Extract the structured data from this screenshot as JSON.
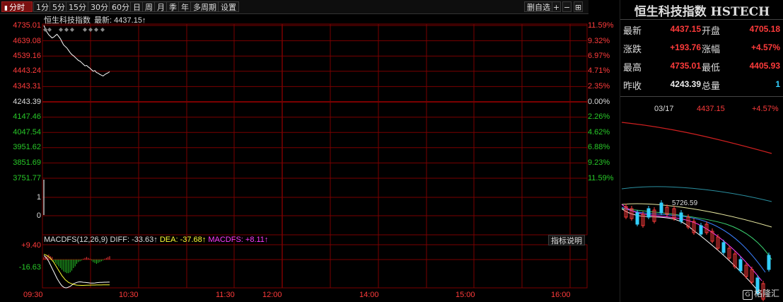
{
  "toolbar": {
    "tabs": [
      "分时",
      "1分",
      "5分",
      "15分",
      "30分",
      "60分",
      "日",
      "周",
      "月",
      "季",
      "年",
      "多周期",
      "设置"
    ],
    "active_index": 0,
    "delete_label": "删自选"
  },
  "chart": {
    "name": "恒生科技指数",
    "latest_label": "最新: 4437.15↑",
    "y_labels_left": [
      "4735.01",
      "4639.08",
      "4539.16",
      "4443.24",
      "4343.31",
      "4243.39",
      "4147.46",
      "4047.54",
      "3951.62",
      "3851.69",
      "3751.77"
    ],
    "y_labels_right": [
      "11.59%",
      "9.32%",
      "6.97%",
      "4.71%",
      "2.35%",
      "0.00%",
      "2.26%",
      "4.62%",
      "6.88%",
      "9.23%",
      "11.59%"
    ],
    "volume_labels": [
      "1",
      "0"
    ],
    "macd_labels": [
      "+9.40",
      "-16.63"
    ],
    "macd_title": "MACDFS(12,26,9)",
    "macd_diff": "DIFF: -33.63↑",
    "macd_dea": "DEA: -37.68↑",
    "macd_value": "MACDFS: +8.11↑",
    "macd_help": "指标说明",
    "time_labels": [
      "09:30",
      "10:30",
      "11:30",
      "12:00",
      "14:00",
      "15:00",
      "16:00"
    ],
    "colors": {
      "up": "#ff3b3b",
      "down": "#28c828",
      "grid": "#7a0000",
      "line": "#ffffff",
      "diff": "#ffffff",
      "dea": "#ffff33"
    },
    "price_series": [
      4735.01,
      4710,
      4690,
      4675,
      4665,
      4655,
      4660,
      4670,
      4678,
      4665,
      4650,
      4630,
      4610,
      4600,
      4590,
      4575,
      4560,
      4548,
      4540,
      4530,
      4520,
      4510,
      4505,
      4495,
      4485,
      4475,
      4478,
      4468,
      4460,
      4450,
      4440,
      4445,
      4432,
      4428,
      4420,
      4415,
      4410,
      4418,
      4425,
      4430,
      4437.15
    ],
    "macd_bars": [
      3,
      4,
      5,
      6,
      4,
      3,
      -2,
      -4,
      -6,
      -8,
      -10,
      -12,
      -14,
      -15,
      -16,
      -16,
      -15,
      -13,
      -10,
      -8,
      -5,
      -3,
      -2,
      -1,
      1,
      2,
      3,
      2,
      1,
      -1,
      -3,
      -4,
      -5,
      -4,
      -3,
      -2,
      -1,
      1,
      2,
      3,
      4
    ],
    "diff_series": [
      6,
      4,
      1,
      -3,
      -8,
      -13,
      -18,
      -23,
      -28,
      -32,
      -36,
      -39,
      -41,
      -42,
      -42,
      -41,
      -40,
      -38,
      -36,
      -35,
      -34,
      -33.5,
      -33.2,
      -33.4,
      -33.8,
      -34,
      -34.2,
      -34.5,
      -34.8,
      -35,
      -35,
      -34.8,
      -34.5,
      -34.2,
      -34,
      -33.9,
      -33.8,
      -33.7,
      -33.65,
      -33.63,
      -33.63
    ],
    "dea_series": [
      8,
      7,
      6,
      4,
      2,
      -1,
      -4,
      -8,
      -12,
      -16,
      -20,
      -24,
      -27,
      -30,
      -32,
      -34,
      -35,
      -36,
      -37,
      -37.5,
      -38,
      -38.2,
      -38.3,
      -38.4,
      -38.4,
      -38.3,
      -38.2,
      -38.1,
      -38,
      -37.9,
      -37.9,
      -37.85,
      -37.8,
      -37.78,
      -37.76,
      -37.74,
      -37.72,
      -37.7,
      -37.69,
      -37.68,
      -37.68
    ]
  },
  "panel": {
    "title": "恒生科技指数 HSTECH",
    "rows": [
      {
        "k1": "最新",
        "v1": "4437.15",
        "k2": "开盘",
        "v2": "4705.18"
      },
      {
        "k1": "涨跌",
        "v1": "+193.76",
        "k2": "涨幅",
        "v2": "+4.57%"
      },
      {
        "k1": "最高",
        "v1": "4735.01",
        "k2": "最低",
        "v2": "4405.93"
      },
      {
        "k1": "昨收",
        "v1": "4243.39",
        "k2": "总量",
        "v2": "1"
      }
    ],
    "mini_date": "03/17",
    "mini_price": "4437.15",
    "mini_change": "+4.57%",
    "mini_marker": "5726.59",
    "watermark": "格隆汇"
  }
}
